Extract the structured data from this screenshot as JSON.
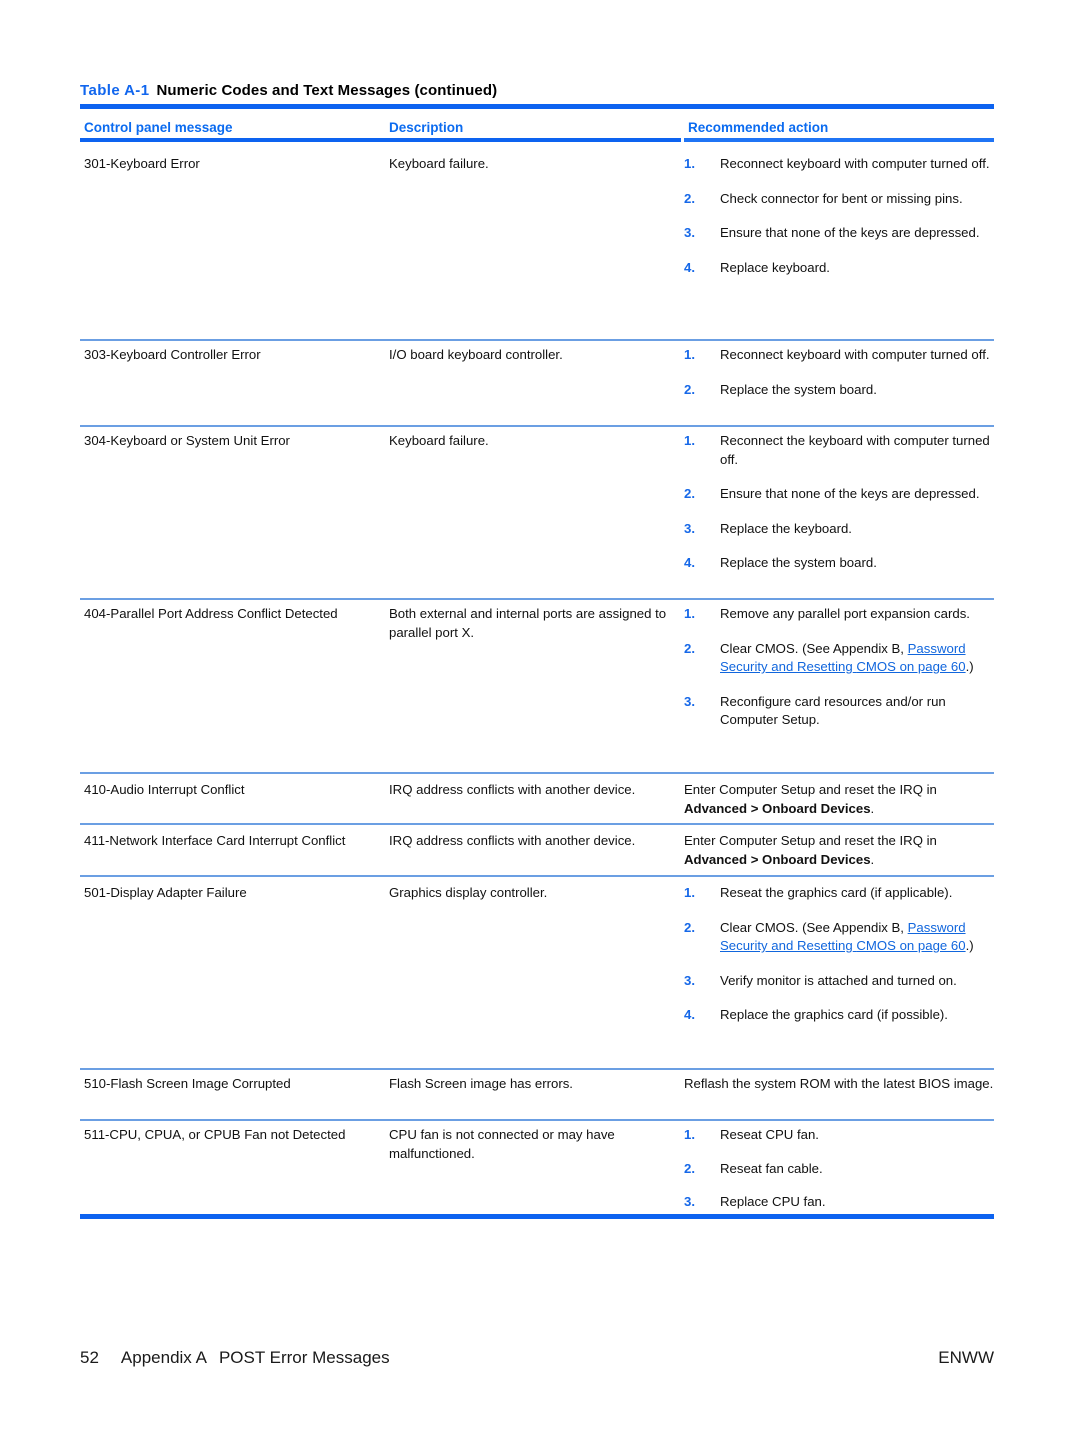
{
  "caption": {
    "number": "Table A-1",
    "text": "Numeric Codes and Text Messages (continued)"
  },
  "columns": {
    "message": "Control panel message",
    "description": "Description",
    "action": "Recommended action"
  },
  "rows": [
    {
      "message": "301-Keyboard Error",
      "description": "Keyboard failure.",
      "steps": [
        "Reconnect keyboard with computer turned off.",
        "Check connector for bent or missing pins.",
        "Ensure that none of the keys are depressed.",
        "Replace keyboard."
      ]
    },
    {
      "message": "303-Keyboard Controller Error",
      "description": "I/O board keyboard controller.",
      "steps": [
        "Reconnect keyboard with computer turned off.",
        "Replace the system board."
      ]
    },
    {
      "message": "304-Keyboard or System Unit Error",
      "description": "Keyboard failure.",
      "steps": [
        "Reconnect the keyboard with computer turned off.",
        "Ensure that none of the keys are depressed.",
        "Replace the keyboard.",
        "Replace the system board."
      ]
    },
    {
      "message": "404-Parallel Port Address Conflict Detected",
      "description": "Both external and internal ports are assigned to parallel port X.",
      "steps": [
        "Remove any parallel port expansion cards.",
        "Clear CMOS. (See Appendix B, Password Security and Resetting CMOS on page 60.)",
        "Reconfigure card resources and/or run Computer Setup."
      ]
    },
    {
      "message": "410-Audio Interrupt Conflict",
      "description": "IRQ address conflicts with another device.",
      "action_prefix": "Enter Computer Setup and reset the IRQ in ",
      "action_bold": "Advanced > Onboard Devices",
      "action_suffix": "."
    },
    {
      "message": "411-Network Interface Card Interrupt Conflict",
      "description": "IRQ address conflicts with another device.",
      "action_prefix": "Enter Computer Setup and reset the IRQ in ",
      "action_bold": "Advanced > Onboard Devices",
      "action_suffix": "."
    },
    {
      "message": "501-Display Adapter Failure",
      "description": "Graphics display controller.",
      "steps": [
        "Reseat the graphics card (if applicable).",
        "Clear CMOS. (See Appendix B, Password Security and Resetting CMOS on page 60.)",
        "Verify monitor is attached and turned on.",
        "Replace the graphics card (if possible)."
      ]
    },
    {
      "message": "510-Flash Screen Image Corrupted",
      "description": "Flash Screen image has errors.",
      "action_plain": "Reflash the system ROM with the latest BIOS image."
    },
    {
      "message": "511-CPU, CPUA, or CPUB Fan not Detected",
      "description": "CPU fan is not connected or may have malfunctioned.",
      "steps": [
        "Reseat CPU fan.",
        "Reseat fan cable.",
        "Replace CPU fan."
      ]
    }
  ],
  "link": {
    "prefix": "Clear CMOS. (See Appendix B, ",
    "text_line1": "Password Security and Resetting",
    "text_line2": "CMOS on page 60",
    "suffix": ".)"
  },
  "step_numbers": [
    "1.",
    "2.",
    "3.",
    "4."
  ],
  "footer": {
    "page_number": "52",
    "appendix": "Appendix A",
    "title": "POST Error Messages",
    "right": "ENWW"
  },
  "colors": {
    "accent_blue": "#0d63f0",
    "header_blue": "#0b6bf0",
    "rule_light": "#6b9fe3",
    "link_blue": "#1166dd"
  }
}
